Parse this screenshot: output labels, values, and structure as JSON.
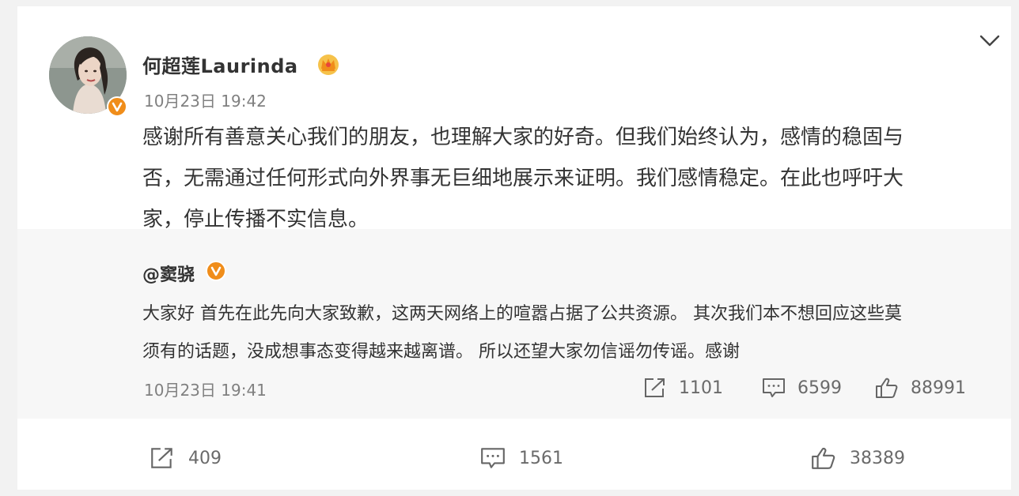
{
  "post": {
    "author": "何超莲Laurinda",
    "time": "10月23日 19:42",
    "lines": [
      "感谢所有善意关心我们的朋友，也理解大家的好奇。但我们始终认为，感情的稳固与",
      "否，无需通过任何形式向外界事无巨细地展示来证明。我们感情稳定。在此也呼吁大",
      "家，停止传播不实信息。"
    ]
  },
  "repost": {
    "author": "@窦骁",
    "lines": [
      "大家好 首先在此先向大家致歉，这两天网络上的喧嚣占据了公共资源。 其次我们本不想回应这些莫",
      "须有的话题，没成想事态变得越来越离谱。 所以还望大家勿信谣勿传谣。感谢"
    ],
    "time": "10月23日 19:41",
    "shares": "1101",
    "comments": "6599",
    "likes": "88991"
  },
  "footer": {
    "shares": "409",
    "comments": "1561",
    "likes": "38389"
  },
  "colors": {
    "badge": "#f08d1a",
    "text": "#333333",
    "muted": "#808080",
    "repost_bg": "#f7f7f7"
  },
  "icons": {
    "verified": "verified-v-icon",
    "member": "crown-icon",
    "menu": "chevron-down-icon",
    "share": "share-icon",
    "comment": "comment-icon",
    "like": "thumbs-up-icon"
  }
}
